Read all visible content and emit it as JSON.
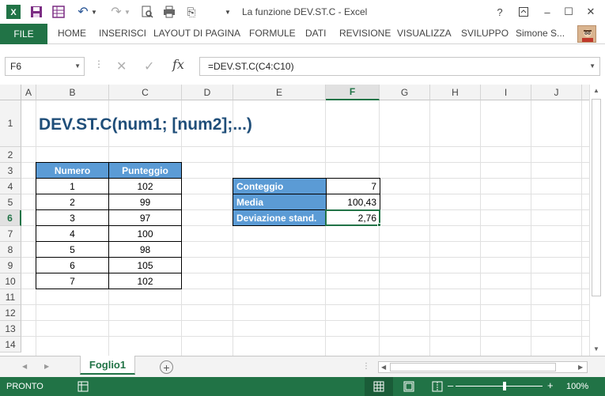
{
  "window": {
    "title": "La funzione DEV.ST.C - Excel",
    "app_icon": "excel-logo-icon",
    "help": "?",
    "minimize": "–",
    "maximize": "☐",
    "close": "✕"
  },
  "ribbon": {
    "file": "FILE",
    "tabs": [
      "HOME",
      "INSERISCI",
      "LAYOUT DI PAGINA",
      "FORMULE",
      "DATI",
      "REVISIONE",
      "VISUALIZZA",
      "SVILUPPO"
    ],
    "user": "Simone S..."
  },
  "formula_bar": {
    "name_box": "F6",
    "fx": "fx",
    "formula": "=DEV.ST.C(C4:C10)"
  },
  "grid": {
    "columns": [
      "A",
      "B",
      "C",
      "D",
      "E",
      "F",
      "G",
      "H",
      "I",
      "J"
    ],
    "rows": [
      "1",
      "2",
      "3",
      "4",
      "5",
      "6",
      "7",
      "8",
      "9",
      "10",
      "11",
      "12",
      "13",
      "14"
    ],
    "selected_column": "F",
    "selected_row": "6"
  },
  "sheet": {
    "title": "DEV.ST.C(num1; [num2];...)",
    "table_headers": [
      "Numero",
      "Punteggio"
    ],
    "table_rows": [
      [
        "1",
        "102"
      ],
      [
        "2",
        "99"
      ],
      [
        "3",
        "97"
      ],
      [
        "4",
        "100"
      ],
      [
        "5",
        "98"
      ],
      [
        "6",
        "105"
      ],
      [
        "7",
        "102"
      ]
    ],
    "stats": [
      {
        "label": "Conteggio",
        "value": "7"
      },
      {
        "label": "Media",
        "value": "100,43"
      },
      {
        "label": "Deviazione stand.",
        "value": "2,76"
      }
    ]
  },
  "tabs_bar": {
    "sheet_name": "Foglio1",
    "add": "+"
  },
  "status": {
    "text": "PRONTO",
    "zoom": "100%",
    "zoom_level_percent": 100
  },
  "colors": {
    "excel_green": "#217346",
    "header_blue": "#5b9bd5",
    "title_blue": "#1f4e79"
  }
}
